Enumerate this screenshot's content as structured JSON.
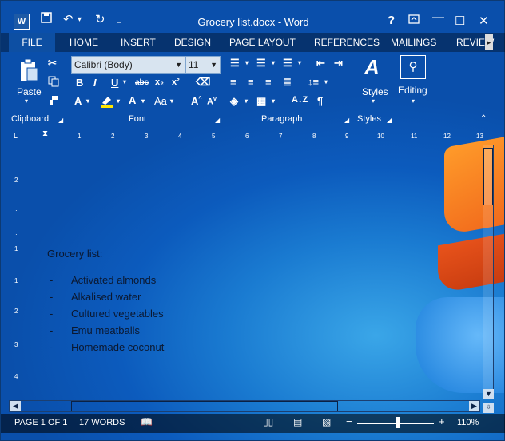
{
  "titlebar": {
    "title": "Grocery list.docx - Word",
    "help": "?",
    "restore_icon": "ribbon-display-icon",
    "min": "—",
    "max": "☐",
    "close": "✕",
    "undo": "↶",
    "undo_drop": "▾",
    "redo": "↻",
    "customize": "₌"
  },
  "tabs": [
    "FILE",
    "HOME",
    "INSERT",
    "DESIGN",
    "PAGE LAYOUT",
    "REFERENCES",
    "MAILINGS",
    "REVIEW"
  ],
  "ribbon": {
    "paste_label": "Paste",
    "font_name": "Calibri (Body)",
    "font_size": "11",
    "styles_label": "Styles",
    "editing_label": "Editing",
    "groups": [
      "Clipboard",
      "Font",
      "Paragraph",
      "Styles"
    ]
  },
  "ruler": [
    "1",
    "1",
    "2",
    "3",
    "4",
    "5",
    "6",
    "7",
    "8",
    "9",
    "10",
    "11",
    "12",
    "13"
  ],
  "vruler": [
    "2",
    "1",
    "1",
    "2",
    "3",
    "4"
  ],
  "document": {
    "heading": "Grocery list:",
    "items": [
      "Activated almonds",
      "Alkalised water",
      "Cultured vegetables",
      "Emu meatballs",
      "Homemade coconut"
    ],
    "bullet": "-"
  },
  "status": {
    "page": "PAGE 1 OF 1",
    "words": "17 WORDS",
    "zoom": "110%",
    "zoom_minus": "−",
    "zoom_plus": "+"
  }
}
